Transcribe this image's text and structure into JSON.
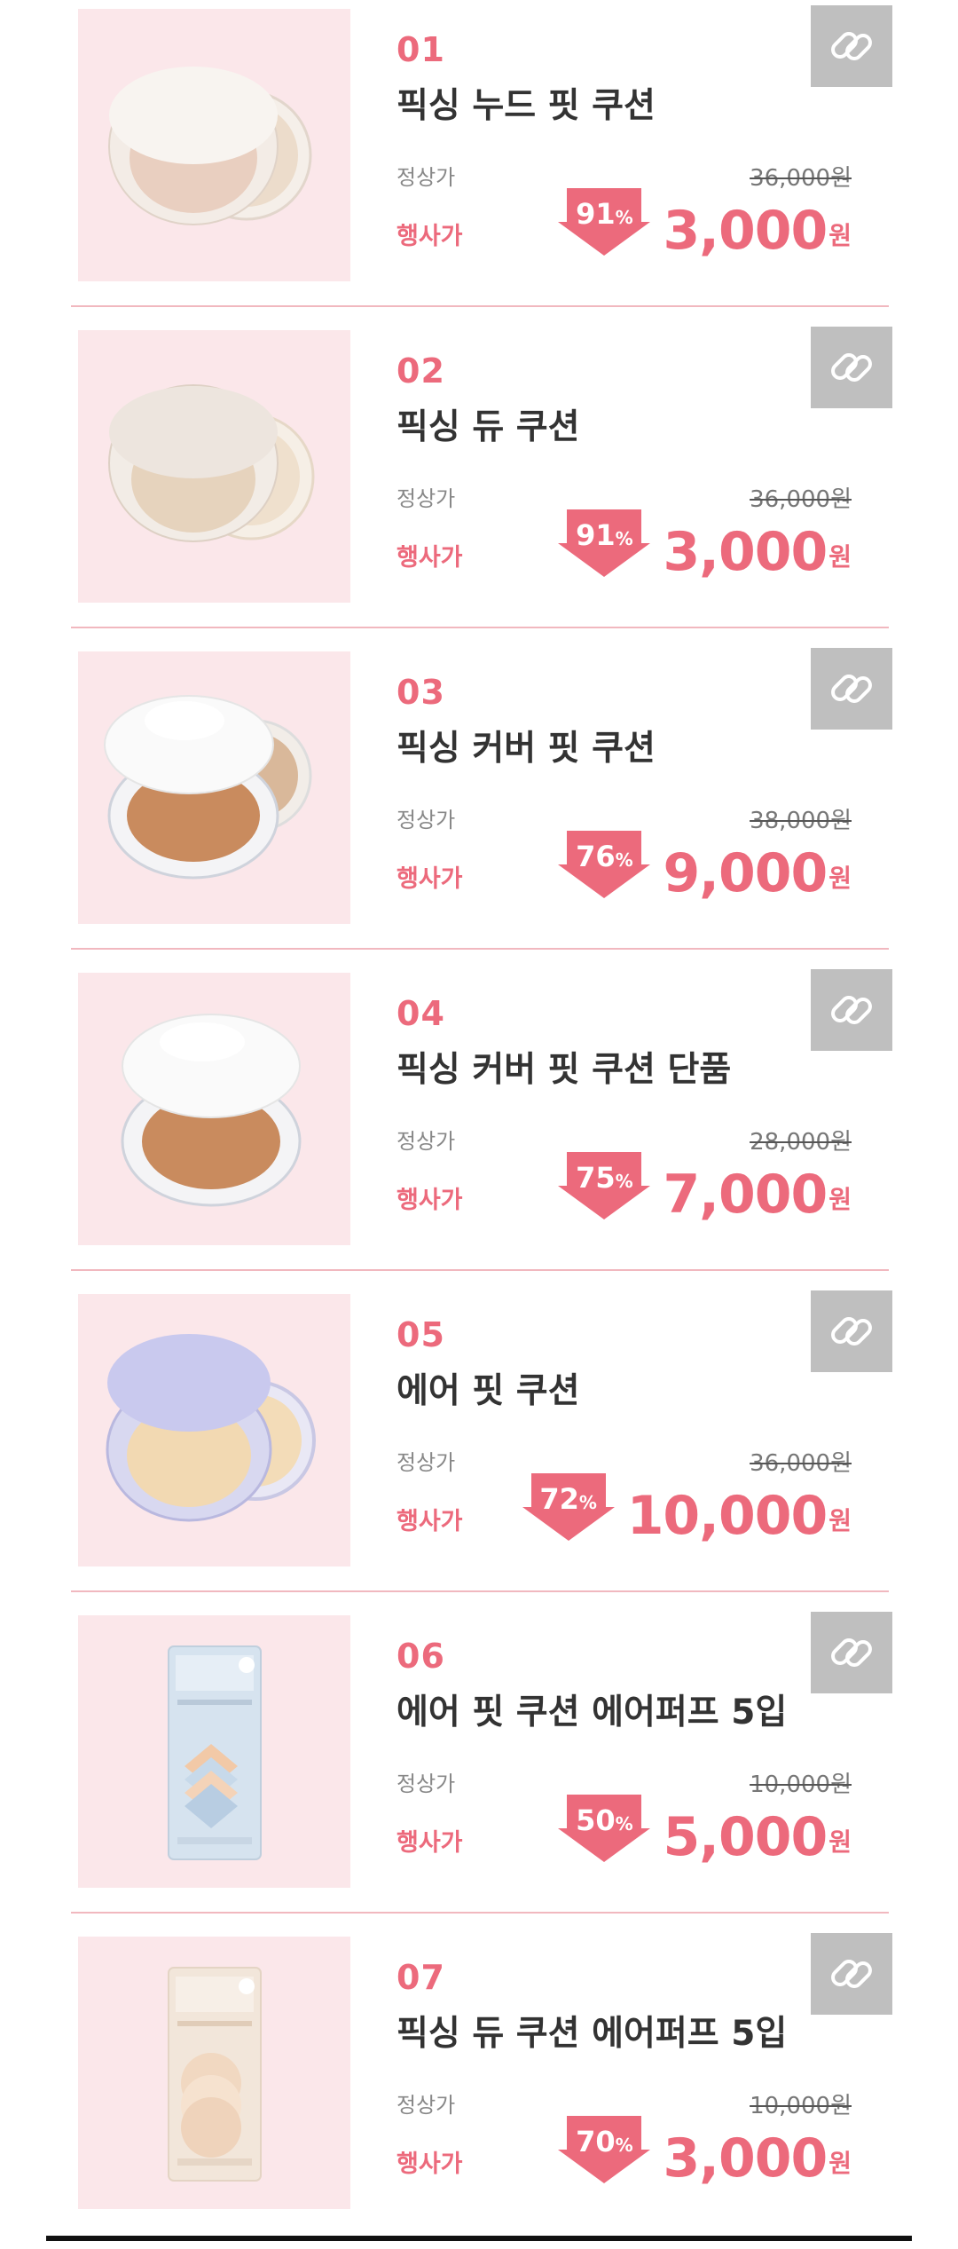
{
  "labels": {
    "regular": "정상가",
    "sale": "행사가",
    "currency": "원",
    "percent": "%"
  },
  "colors": {
    "accent": "#ec6a7c",
    "thumb_bg": "#fbe7ea",
    "link_bg": "#bfbfbf",
    "divider": "#f1b8bf"
  },
  "products": [
    {
      "num": "01",
      "name": "픽싱 누드 핏 쿠션",
      "original": "36,000원",
      "discount": "91",
      "price": "3,000",
      "image": "beige-cushion-compact"
    },
    {
      "num": "02",
      "name": "픽싱 듀 쿠션",
      "original": "36,000원",
      "discount": "91",
      "price": "3,000",
      "image": "beige-cushion-compact"
    },
    {
      "num": "03",
      "name": "픽싱 커버 핏 쿠션",
      "original": "38,000원",
      "discount": "76",
      "price": "9,000",
      "image": "white-cushion-compact"
    },
    {
      "num": "04",
      "name": "픽싱 커버 핏 쿠션 단품",
      "original": "28,000원",
      "discount": "75",
      "price": "7,000",
      "image": "white-cushion-compact"
    },
    {
      "num": "05",
      "name": "에어 핏 쿠션",
      "original": "36,000원",
      "discount": "72",
      "price": "10,000",
      "image": "lavender-cushion-compact"
    },
    {
      "num": "06",
      "name": "에어 핏 쿠션 에어퍼프 5입",
      "original": "10,000원",
      "discount": "50",
      "price": "5,000",
      "image": "blue-puff-package"
    },
    {
      "num": "07",
      "name": "픽싱 듀 쿠션 에어퍼프 5입",
      "original": "10,000원",
      "discount": "70",
      "price": "3,000",
      "image": "beige-puff-package"
    }
  ]
}
